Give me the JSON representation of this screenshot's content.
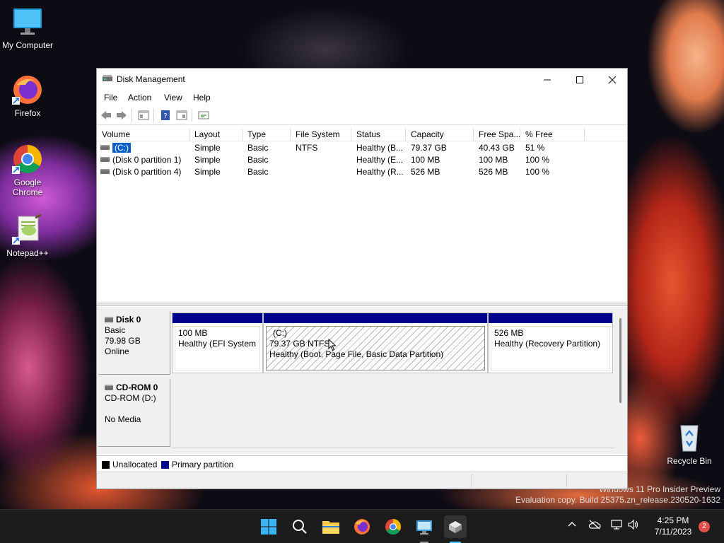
{
  "desktop": {
    "icons": [
      {
        "label": "My Computer"
      },
      {
        "label": "Firefox"
      },
      {
        "label": "Google Chrome"
      },
      {
        "label": "Notepad++"
      },
      {
        "label": "Recycle Bin"
      }
    ],
    "watermark": {
      "line1": "Windows 11 Pro Insider Preview",
      "line2": "Evaluation copy. Build 25375.zn_release.230520-1632"
    }
  },
  "window": {
    "title": "Disk Management",
    "menu": [
      "File",
      "Action",
      "View",
      "Help"
    ],
    "columns": [
      "Volume",
      "Layout",
      "Type",
      "File System",
      "Status",
      "Capacity",
      "Free Spa...",
      "% Free"
    ],
    "rows": [
      {
        "volume": "(C:)",
        "layout": "Simple",
        "type": "Basic",
        "fs": "NTFS",
        "status": "Healthy (B...",
        "capacity": "79.37 GB",
        "free": "40.43 GB",
        "pct": "51 %"
      },
      {
        "volume": "(Disk 0 partition 1)",
        "layout": "Simple",
        "type": "Basic",
        "fs": "",
        "status": "Healthy (E...",
        "capacity": "100 MB",
        "free": "100 MB",
        "pct": "100 %"
      },
      {
        "volume": "(Disk 0 partition 4)",
        "layout": "Simple",
        "type": "Basic",
        "fs": "",
        "status": "Healthy (R...",
        "capacity": "526 MB",
        "free": "526 MB",
        "pct": "100 %"
      }
    ],
    "disks": [
      {
        "name": "Disk 0",
        "type": "Basic",
        "size": "79.98 GB",
        "state": "Online",
        "partitions": [
          {
            "title": "",
            "size": "100 MB",
            "status": "Healthy (EFI System P"
          },
          {
            "title": "(C:)",
            "size": "79.37 GB NTFS",
            "status": "Healthy (Boot, Page File, Basic Data Partition)"
          },
          {
            "title": "",
            "size": "526 MB",
            "status": "Healthy (Recovery Partition)"
          }
        ]
      },
      {
        "name": "CD-ROM 0",
        "type": "CD-ROM (D:)",
        "state": "No Media"
      }
    ],
    "legend": [
      {
        "label": "Unallocated",
        "color": "#000000"
      },
      {
        "label": "Primary partition",
        "color": "#00008b"
      }
    ]
  },
  "taskbar": {
    "time": "4:25 PM",
    "date": "7/11/2023",
    "notifications": "2"
  }
}
